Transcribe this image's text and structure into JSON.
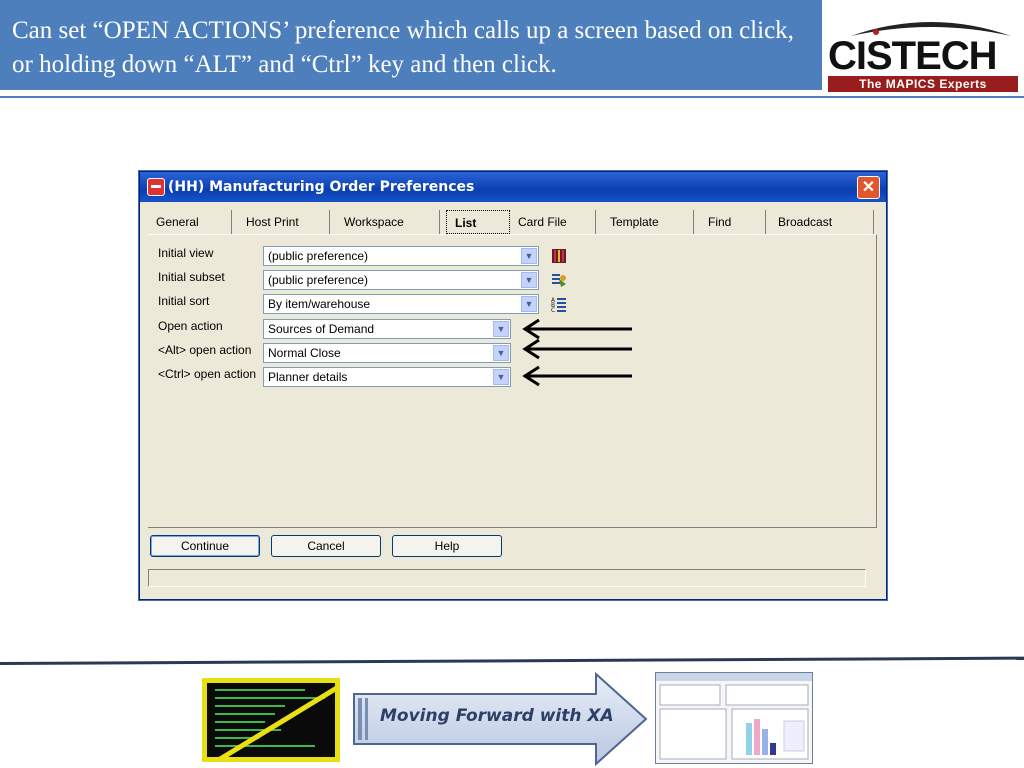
{
  "slide": {
    "title": "Can set “OPEN ACTIONS’ preference which calls up a screen based on click, or holding down “ALT” and “Ctrl” key and then click.",
    "logo_word": "CISTECH",
    "logo_tagline": "The MAPICS Experts"
  },
  "dialog": {
    "title": "(HH) Manufacturing Order Preferences",
    "tabs": [
      {
        "label": "General"
      },
      {
        "label": "Host Print"
      },
      {
        "label": "Workspace"
      },
      {
        "label": "List",
        "active": true
      },
      {
        "label": "Card File"
      },
      {
        "label": "Template"
      },
      {
        "label": "Find"
      },
      {
        "label": "Broadcast"
      }
    ],
    "fields": [
      {
        "label": "Initial view",
        "value": "(public preference)",
        "icon": "view-icon"
      },
      {
        "label": "Initial subset",
        "value": "(public preference)",
        "icon": "subset-icon"
      },
      {
        "label": "Initial sort",
        "value": "By item/warehouse",
        "icon": "sort-icon"
      },
      {
        "label": "Open action",
        "value": "Sources of Demand"
      },
      {
        "label": "<Alt> open action",
        "value": "Normal Close"
      },
      {
        "label": "<Ctrl> open action",
        "value": "Planner details"
      }
    ],
    "buttons": {
      "continue": "Continue",
      "cancel": "Cancel",
      "help": "Help"
    }
  },
  "footer": {
    "banner_text": "Moving Forward with XA"
  },
  "colors": {
    "header_blue": "#4d7fbd",
    "titlebar_blue": "#0a3fb0",
    "dialog_bg": "#ece9d8",
    "highlight_yellow": "#e8e012"
  }
}
